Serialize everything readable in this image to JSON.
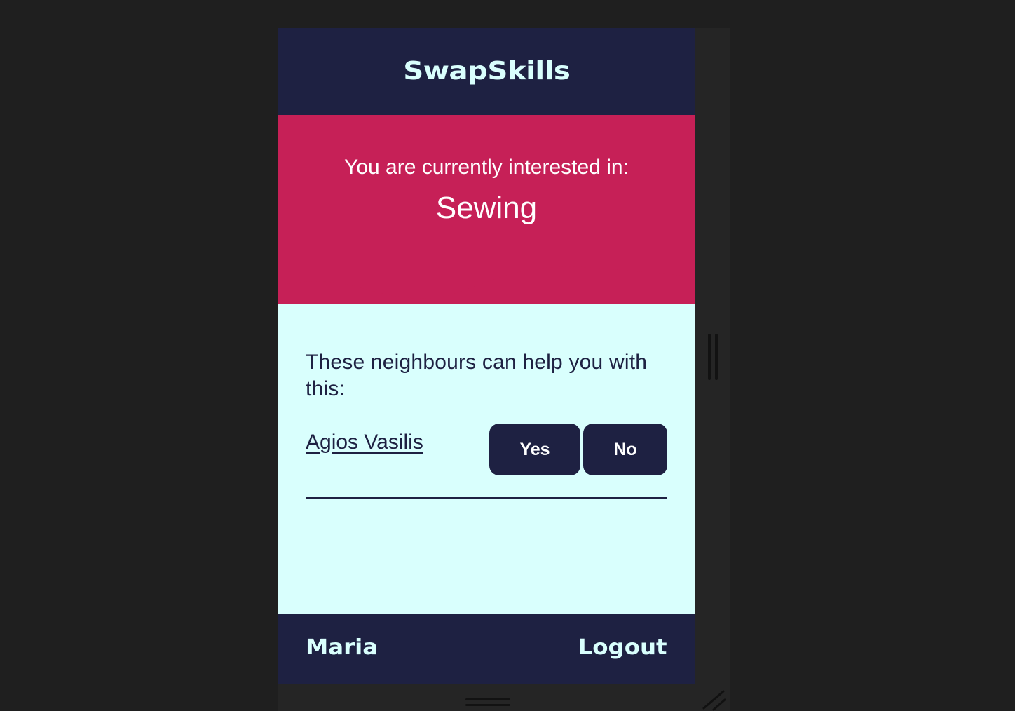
{
  "app": {
    "logo_text": "SwapSkills"
  },
  "interest": {
    "label": "You are currently interested in:",
    "value": "Sewing"
  },
  "neighbours": {
    "intro": "These neighbours can help you with this:",
    "items": [
      {
        "name": "Agios Vasilis",
        "yes_label": "Yes",
        "no_label": "No"
      }
    ]
  },
  "footer": {
    "user_name": "Maria",
    "logout_label": "Logout"
  },
  "colors": {
    "header_bg": "#1e2142",
    "accent": "#c62057",
    "content_bg": "#d9fffd",
    "button_bg": "#1e2142",
    "text_light": "#ffffff"
  }
}
